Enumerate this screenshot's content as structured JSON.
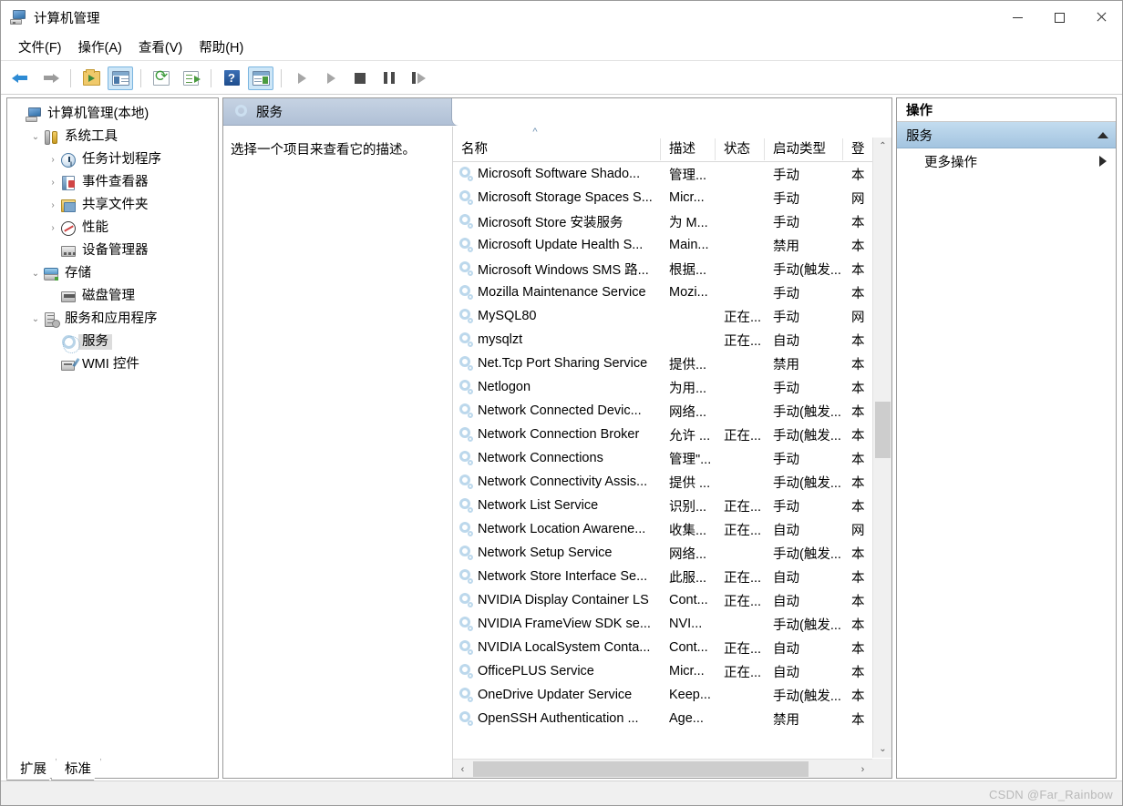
{
  "window": {
    "title": "计算机管理",
    "icon": "computer-management-icon",
    "minimize_label": "最小化",
    "maximize_label": "最大化",
    "close_label": "关闭"
  },
  "menubar": {
    "items": [
      {
        "label": "文件(F)",
        "name": "menu-file"
      },
      {
        "label": "操作(A)",
        "name": "menu-action"
      },
      {
        "label": "查看(V)",
        "name": "menu-view"
      },
      {
        "label": "帮助(H)",
        "name": "menu-help"
      }
    ]
  },
  "toolbar": {
    "buttons": [
      {
        "name": "back-button",
        "icon": "arrow-left-icon",
        "active": false
      },
      {
        "name": "forward-button",
        "icon": "arrow-right-icon",
        "active": false
      },
      {
        "name": "up-folder-button",
        "icon": "folder-up-icon",
        "active": false
      },
      {
        "name": "show-hide-console-tree-button",
        "icon": "console-tree-icon",
        "active": true
      },
      {
        "name": "refresh-button",
        "icon": "refresh-icon",
        "active": false
      },
      {
        "name": "export-list-button",
        "icon": "export-list-icon",
        "active": false
      },
      {
        "name": "help-button",
        "icon": "help-icon",
        "active": false
      },
      {
        "name": "show-action-pane-button",
        "icon": "action-pane-icon",
        "active": true
      },
      {
        "name": "start-service-button",
        "icon": "play-icon",
        "active": false
      },
      {
        "name": "resume-service-button",
        "icon": "play-icon",
        "active": false
      },
      {
        "name": "stop-service-button",
        "icon": "stop-icon",
        "active": false
      },
      {
        "name": "pause-service-button",
        "icon": "pause-icon",
        "active": false
      },
      {
        "name": "restart-service-button",
        "icon": "restart-icon",
        "active": false
      }
    ]
  },
  "tree": {
    "nodes": [
      {
        "label": "计算机管理(本地)",
        "indent": 0,
        "twisty": "",
        "icon": "computer-management-icon",
        "selected": false
      },
      {
        "label": "系统工具",
        "indent": 1,
        "twisty": "v",
        "icon": "system-tools-icon",
        "selected": false
      },
      {
        "label": "任务计划程序",
        "indent": 2,
        "twisty": ">",
        "icon": "task-scheduler-icon",
        "selected": false
      },
      {
        "label": "事件查看器",
        "indent": 2,
        "twisty": ">",
        "icon": "event-viewer-icon",
        "selected": false
      },
      {
        "label": "共享文件夹",
        "indent": 2,
        "twisty": ">",
        "icon": "shared-folders-icon",
        "selected": false
      },
      {
        "label": "性能",
        "indent": 2,
        "twisty": ">",
        "icon": "performance-icon",
        "selected": false
      },
      {
        "label": "设备管理器",
        "indent": 2,
        "twisty": "",
        "icon": "device-manager-icon",
        "selected": false
      },
      {
        "label": "存储",
        "indent": 1,
        "twisty": "v",
        "icon": "storage-icon",
        "selected": false
      },
      {
        "label": "磁盘管理",
        "indent": 2,
        "twisty": "",
        "icon": "disk-management-icon",
        "selected": false
      },
      {
        "label": "服务和应用程序",
        "indent": 1,
        "twisty": "v",
        "icon": "services-and-apps-icon",
        "selected": false
      },
      {
        "label": "服务",
        "indent": 2,
        "twisty": "",
        "icon": "services-gear-icon",
        "selected": true
      },
      {
        "label": "WMI 控件",
        "indent": 2,
        "twisty": "",
        "icon": "wmi-control-icon",
        "selected": false
      }
    ]
  },
  "result_pane": {
    "header_title": "服务",
    "header_icon": "services-gear-icon",
    "description_placeholder": "选择一个项目来查看它的描述。",
    "sort_indicator": "^",
    "columns": [
      {
        "label": "名称",
        "name": "column-name"
      },
      {
        "label": "描述",
        "name": "column-description"
      },
      {
        "label": "状态",
        "name": "column-status"
      },
      {
        "label": "启动类型",
        "name": "column-startup-type"
      },
      {
        "label": "登",
        "name": "column-logon-as"
      }
    ],
    "rows": [
      {
        "name": "Microsoft Software Shado...",
        "description": "管理...",
        "status": "",
        "startup": "手动",
        "logon": "本"
      },
      {
        "name": "Microsoft Storage Spaces S...",
        "description": "Micr...",
        "status": "",
        "startup": "手动",
        "logon": "网"
      },
      {
        "name": "Microsoft Store 安装服务",
        "description": "为 M...",
        "status": "",
        "startup": "手动",
        "logon": "本"
      },
      {
        "name": "Microsoft Update Health S...",
        "description": "Main...",
        "status": "",
        "startup": "禁用",
        "logon": "本"
      },
      {
        "name": "Microsoft Windows SMS 路...",
        "description": "根据...",
        "status": "",
        "startup": "手动(触发...",
        "logon": "本"
      },
      {
        "name": "Mozilla Maintenance Service",
        "description": "Mozi...",
        "status": "",
        "startup": "手动",
        "logon": "本"
      },
      {
        "name": "MySQL80",
        "description": "",
        "status": "正在...",
        "startup": "手动",
        "logon": "网"
      },
      {
        "name": "mysqlzt",
        "description": "",
        "status": "正在...",
        "startup": "自动",
        "logon": "本"
      },
      {
        "name": "Net.Tcp Port Sharing Service",
        "description": "提供...",
        "status": "",
        "startup": "禁用",
        "logon": "本"
      },
      {
        "name": "Netlogon",
        "description": "为用...",
        "status": "",
        "startup": "手动",
        "logon": "本"
      },
      {
        "name": "Network Connected Devic...",
        "description": "网络...",
        "status": "",
        "startup": "手动(触发...",
        "logon": "本"
      },
      {
        "name": "Network Connection Broker",
        "description": "允许 ...",
        "status": "正在...",
        "startup": "手动(触发...",
        "logon": "本"
      },
      {
        "name": "Network Connections",
        "description": "管理\"...",
        "status": "",
        "startup": "手动",
        "logon": "本"
      },
      {
        "name": "Network Connectivity Assis...",
        "description": "提供 ...",
        "status": "",
        "startup": "手动(触发...",
        "logon": "本"
      },
      {
        "name": "Network List Service",
        "description": "识别...",
        "status": "正在...",
        "startup": "手动",
        "logon": "本"
      },
      {
        "name": "Network Location Awarene...",
        "description": "收集...",
        "status": "正在...",
        "startup": "自动",
        "logon": "网"
      },
      {
        "name": "Network Setup Service",
        "description": "网络...",
        "status": "",
        "startup": "手动(触发...",
        "logon": "本"
      },
      {
        "name": "Network Store Interface Se...",
        "description": "此服...",
        "status": "正在...",
        "startup": "自动",
        "logon": "本"
      },
      {
        "name": "NVIDIA Display Container LS",
        "description": "Cont...",
        "status": "正在...",
        "startup": "自动",
        "logon": "本"
      },
      {
        "name": "NVIDIA FrameView SDK se...",
        "description": "NVI...",
        "status": "",
        "startup": "手动(触发...",
        "logon": "本"
      },
      {
        "name": "NVIDIA LocalSystem Conta...",
        "description": "Cont...",
        "status": "正在...",
        "startup": "自动",
        "logon": "本"
      },
      {
        "name": "OfficePLUS Service",
        "description": "Micr...",
        "status": "正在...",
        "startup": "自动",
        "logon": "本"
      },
      {
        "name": "OneDrive Updater Service",
        "description": "Keep...",
        "status": "",
        "startup": "手动(触发...",
        "logon": "本"
      },
      {
        "name": "OpenSSH Authentication ...",
        "description": "Age...",
        "status": "",
        "startup": "禁用",
        "logon": "本"
      }
    ],
    "scroll": {
      "up_arrow": "⌃",
      "down_arrow": "⌄",
      "left_arrow": "‹",
      "right_arrow": "›"
    }
  },
  "view_tabs": [
    {
      "label": "扩展",
      "name": "tab-extended",
      "active": false
    },
    {
      "label": "标准",
      "name": "tab-standard",
      "active": true
    }
  ],
  "actions_pane": {
    "title": "操作",
    "section_label": "服务",
    "collapse_icon": "chevron-up-icon",
    "items": [
      {
        "label": "更多操作",
        "name": "action-more-actions",
        "submenu_icon": "chevron-right-icon"
      }
    ]
  },
  "watermark": "CSDN @Far_Rainbow",
  "colors": {
    "header_bar": "#b8c6d9",
    "action_section": "#a8c6e0",
    "selection": "#dcdcdc",
    "scrollbar_thumb": "#cdcdcd"
  }
}
